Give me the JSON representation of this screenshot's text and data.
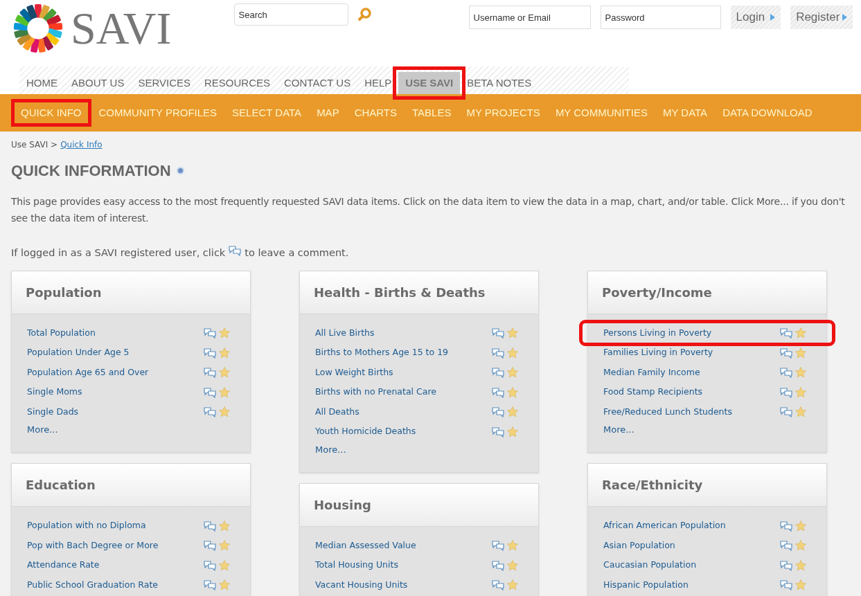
{
  "header": {
    "logo_text": "SAVI",
    "search": {
      "placeholder": "Search"
    },
    "username": {
      "placeholder": "Username or Email"
    },
    "password": {
      "placeholder": "Password"
    },
    "login": "Login",
    "register": "Register"
  },
  "main_nav": [
    {
      "label": "HOME",
      "selected": false,
      "highlighted": false
    },
    {
      "label": "ABOUT US",
      "selected": false,
      "highlighted": false
    },
    {
      "label": "SERVICES",
      "selected": false,
      "highlighted": false
    },
    {
      "label": "RESOURCES",
      "selected": false,
      "highlighted": false
    },
    {
      "label": "CONTACT US",
      "selected": false,
      "highlighted": false
    },
    {
      "label": "HELP",
      "selected": false,
      "highlighted": false
    },
    {
      "label": "USE SAVI",
      "selected": true,
      "highlighted": true
    },
    {
      "label": "BETA NOTES",
      "selected": false,
      "highlighted": false
    }
  ],
  "sub_nav": [
    {
      "label": "QUICK INFO",
      "highlighted": true
    },
    {
      "label": "COMMUNITY PROFILES",
      "highlighted": false
    },
    {
      "label": "SELECT DATA",
      "highlighted": false
    },
    {
      "label": "MAP",
      "highlighted": false
    },
    {
      "label": "CHARTS",
      "highlighted": false
    },
    {
      "label": "TABLES",
      "highlighted": false
    },
    {
      "label": "MY PROJECTS",
      "highlighted": false
    },
    {
      "label": "MY COMMUNITIES",
      "highlighted": false
    },
    {
      "label": "MY DATA",
      "highlighted": false
    },
    {
      "label": "DATA DOWNLOAD",
      "highlighted": false
    }
  ],
  "breadcrumb": {
    "parent": "Use SAVI >",
    "current": "Quick Info"
  },
  "title": "QUICK INFORMATION",
  "intro": "This page provides easy access to the most frequently requested SAVI data items. Click on the data item to view the data in a map, chart, and/or table. Click More... if you don't see the data item of interest.",
  "comment_hint": {
    "before": "If logged in as a SAVI registered user, click",
    "after": "to leave a comment."
  },
  "columns": [
    {
      "cards": [
        {
          "title": "Population",
          "items": [
            {
              "label": "Total Population",
              "highlighted": false
            },
            {
              "label": "Population Under Age 5",
              "highlighted": false
            },
            {
              "label": "Population Age 65 and Over",
              "highlighted": false
            },
            {
              "label": "Single Moms",
              "highlighted": false
            },
            {
              "label": "Single Dads",
              "highlighted": false
            }
          ],
          "more": "More..."
        },
        {
          "title": "Education",
          "items": [
            {
              "label": "Population with no Diploma",
              "highlighted": false
            },
            {
              "label": "Pop with Bach Degree or More",
              "highlighted": false
            },
            {
              "label": "Attendance Rate",
              "highlighted": false
            },
            {
              "label": "Public School Graduation Rate",
              "highlighted": false
            }
          ]
        }
      ]
    },
    {
      "cards": [
        {
          "title": "Health - Births & Deaths",
          "items": [
            {
              "label": "All Live Births",
              "highlighted": false
            },
            {
              "label": "Births to Mothers Age 15 to 19",
              "highlighted": false
            },
            {
              "label": "Low Weight Births",
              "highlighted": false
            },
            {
              "label": "Births with no Prenatal Care",
              "highlighted": false
            },
            {
              "label": "All Deaths",
              "highlighted": false
            },
            {
              "label": "Youth Homicide Deaths",
              "highlighted": false
            }
          ],
          "more": "More..."
        },
        {
          "title": "Housing",
          "items": [
            {
              "label": "Median Assessed Value",
              "highlighted": false
            },
            {
              "label": "Total Housing Units",
              "highlighted": false
            },
            {
              "label": "Vacant Housing Units",
              "highlighted": false
            }
          ]
        }
      ]
    },
    {
      "cards": [
        {
          "title": "Poverty/Income",
          "items": [
            {
              "label": "Persons Living in Poverty",
              "highlighted": true
            },
            {
              "label": "Families Living in Poverty",
              "highlighted": false
            },
            {
              "label": "Median Family Income",
              "highlighted": false
            },
            {
              "label": "Food Stamp Recipients",
              "highlighted": false
            },
            {
              "label": "Free/Reduced Lunch Students",
              "highlighted": false
            }
          ],
          "more": "More..."
        },
        {
          "title": "Race/Ethnicity",
          "items": [
            {
              "label": "African American Population",
              "highlighted": false
            },
            {
              "label": "Asian Population",
              "highlighted": false
            },
            {
              "label": "Caucasian Population",
              "highlighted": false
            },
            {
              "label": "Hispanic Population",
              "highlighted": false
            }
          ]
        }
      ]
    }
  ]
}
